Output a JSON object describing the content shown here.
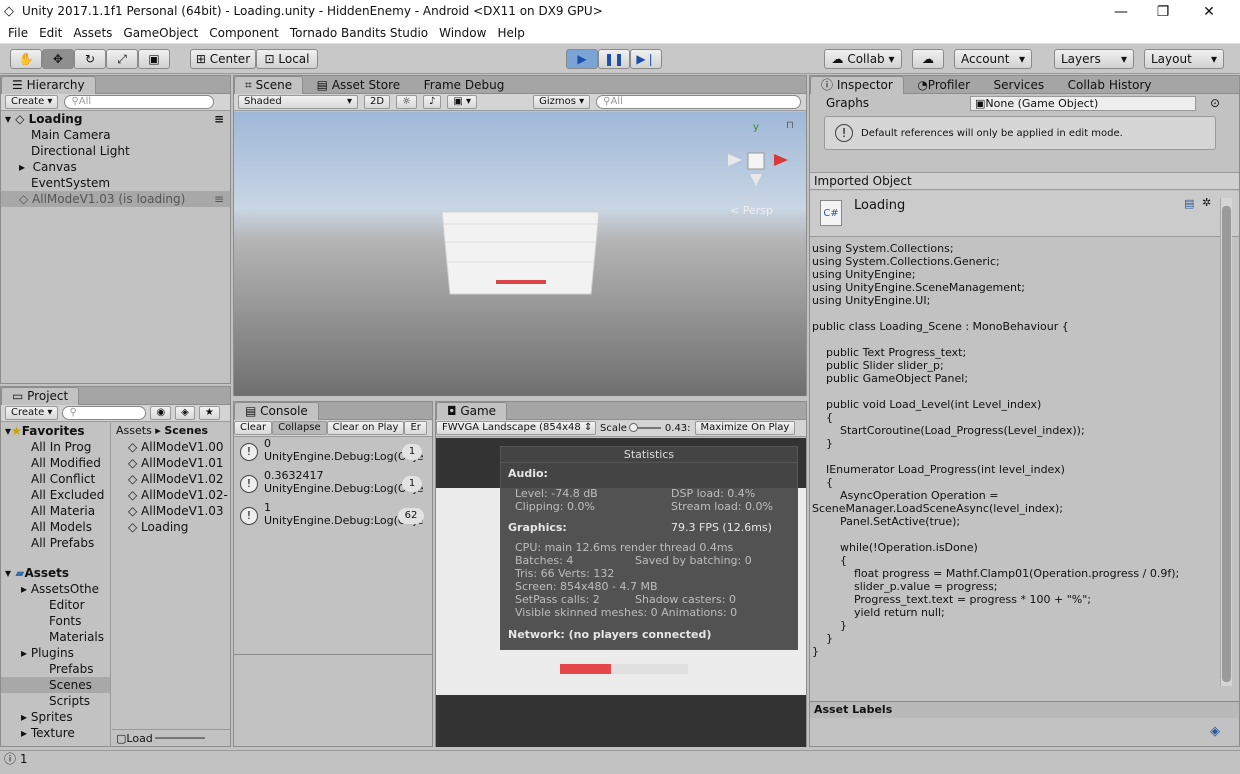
{
  "titlebar": {
    "title": "Unity 2017.1.1f1 Personal (64bit) - Loading.unity - HiddenEnemy - Android <DX11 on DX9 GPU>",
    "minimize": "—",
    "maximize": "❐",
    "close": "✕"
  },
  "menu": [
    "File",
    "Edit",
    "Assets",
    "GameObject",
    "Component",
    "Tornado Bandits Studio",
    "Window",
    "Help"
  ],
  "toolbar": {
    "center": "Center",
    "local": "Local",
    "collab": "Collab",
    "account": "Account",
    "layers": "Layers",
    "layout": "Layout"
  },
  "hierarchy": {
    "tab": "Hierarchy",
    "create": "Create",
    "search": "All",
    "scene": "Loading",
    "items": [
      "Main Camera",
      "Directional Light",
      "Canvas",
      "EventSystem"
    ],
    "loading_scene": "AllModeV1.03 (is loading)"
  },
  "scene": {
    "tabs": [
      "Scene",
      "Asset Store",
      "Frame Debug"
    ],
    "shaded": "Shaded",
    "mode2d": "2D",
    "gizmos": "Gizmos",
    "search": "All",
    "persp": "Persp",
    "axis_y": "y"
  },
  "project": {
    "tab": "Project",
    "create": "Create",
    "favorites": "Favorites",
    "fav_items": [
      "All In Prog",
      "All Modified",
      "All Conflict",
      "All Excluded",
      "All Materia",
      "All Models",
      "All Prefabs"
    ],
    "assets": "Assets",
    "asset_items": [
      "AssetsOthe",
      "Editor",
      "Fonts",
      "Materials",
      "Plugins",
      "Prefabs",
      "Scenes",
      "Scripts",
      "Sprites",
      "Texture"
    ],
    "breadcrumb_root": "Assets",
    "breadcrumb_leaf": "Scenes",
    "files": [
      "AllModeV1.00",
      "AllModeV1.01",
      "AllModeV1.02",
      "AllModeV1.02-",
      "AllModeV1.03",
      "Loading"
    ],
    "footer": "Load"
  },
  "console": {
    "tab": "Console",
    "buttons": [
      "Clear",
      "Collapse",
      "Clear on Play",
      "Er"
    ],
    "entries": [
      {
        "value": "0",
        "text": "UnityEngine.Debug:Log(Obje",
        "count": "1"
      },
      {
        "value": "0.3632417",
        "text": "UnityEngine.Debug:Log(Obje",
        "count": "1"
      },
      {
        "value": "1",
        "text": "UnityEngine.Debug:Log(Obje",
        "count": "62"
      }
    ]
  },
  "game": {
    "tab": "Game",
    "resolution": "FWVGA Landscape (854x48",
    "scale_label": "Scale",
    "scale_value": "0.43:",
    "maximize": "Maximize On Play",
    "progress": 0.4,
    "stats": {
      "title": "Statistics",
      "audio": "Audio:",
      "level": "Level: -74.8 dB",
      "clipping": "Clipping: 0.0%",
      "dsp": "DSP load: 0.4%",
      "stream": "Stream load: 0.0%",
      "graphics": "Graphics:",
      "fps": "79.3 FPS (12.6ms)",
      "cpu": "CPU: main 12.6ms  render thread 0.4ms",
      "batches": "Batches: 4",
      "saved": "Saved by batching: 0",
      "tris": "Tris: 66   Verts: 132",
      "screen": "Screen: 854x480 - 4.7 MB",
      "setpass": "SetPass calls: 2",
      "shadow": "Shadow casters: 0",
      "skinned": "Visible skinned meshes: 0  Animations: 0",
      "network": "Network: (no players connected)"
    }
  },
  "inspector": {
    "tabs": [
      "Inspector",
      "Profiler",
      "Services",
      "Collab History"
    ],
    "graphs_label": "Graphs",
    "graphs_value": "None (Game Object)",
    "notice": "Default references will only be applied in edit mode.",
    "imported": "Imported Object",
    "script_name": "Loading",
    "cs": "C#",
    "asset_labels": "Asset Labels",
    "code": "using System.Collections;\nusing System.Collections.Generic;\nusing UnityEngine;\nusing UnityEngine.SceneManagement;\nusing UnityEngine.UI;\n\npublic class Loading_Scene : MonoBehaviour {\n\n    public Text Progress_text;\n    public Slider slider_p;\n    public GameObject Panel;\n\n    public void Load_Level(int Level_index)\n    {\n        StartCoroutine(Load_Progress(Level_index));\n    }\n\n    IEnumerator Load_Progress(int level_index)\n    {\n        AsyncOperation Operation =\nSceneManager.LoadSceneAsync(level_index);\n        Panel.SetActive(true);\n\n        while(!Operation.isDone)\n        {\n            float progress = Mathf.Clamp01(Operation.progress / 0.9f);\n            slider_p.value = progress;\n            Progress_text.text = progress * 100 + \"%\";\n            yield return null;\n        }\n    }\n}"
  },
  "statusbar": {
    "text": "1"
  }
}
